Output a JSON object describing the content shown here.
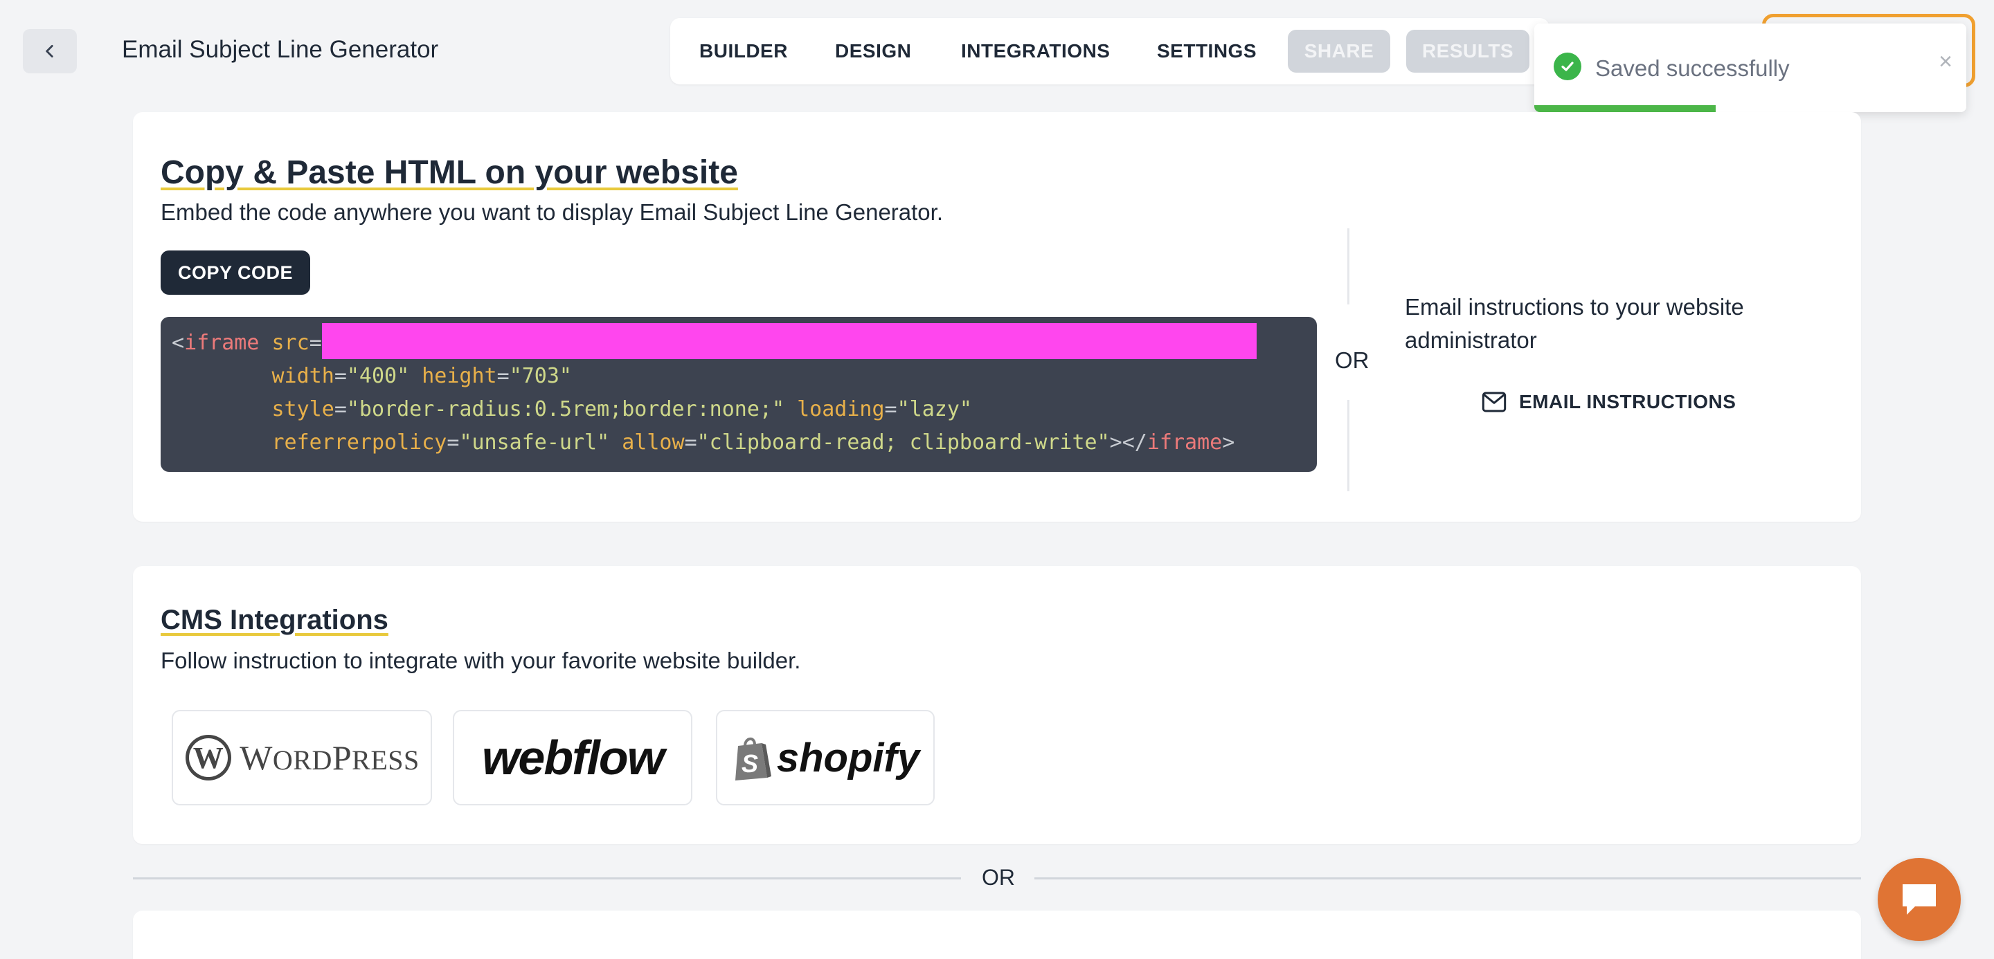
{
  "header": {
    "back_label": "back",
    "title": "Email Subject Line Generator",
    "tabs": [
      {
        "label": "BUILDER",
        "state": "normal"
      },
      {
        "label": "DESIGN",
        "state": "normal"
      },
      {
        "label": "INTEGRATIONS",
        "state": "normal"
      },
      {
        "label": "SETTINGS",
        "state": "normal"
      },
      {
        "label": "SHARE",
        "state": "disabled"
      },
      {
        "label": "RESULTS",
        "state": "disabled"
      }
    ]
  },
  "toast": {
    "message": "Saved successfully",
    "close_glyph": "×",
    "progress": 0.42,
    "accent": "#4cb648"
  },
  "embed": {
    "title": "Copy & Paste HTML on your website",
    "subtitle": "Embed the code anywhere you want to display Email Subject Line Generator.",
    "copy_button": "COPY CODE",
    "code": {
      "tag_open": "iframe",
      "src_attr": "src",
      "width_attr": "width",
      "width_val": "\"400\"",
      "height_attr": "height",
      "height_val": "\"703\"",
      "style_attr": "style",
      "style_val": "\"border-radius:0.5rem;border:none;\"",
      "loading_attr": "loading",
      "loading_val": "\"lazy\"",
      "referrer_attr": "referrerpolicy",
      "referrer_val": "\"unsafe-url\"",
      "allow_attr": "allow",
      "allow_val": "\"clipboard-read; clipboard-write\"",
      "tag_close": "iframe"
    },
    "or_label": "OR",
    "email_text": "Email instructions to your website administrator",
    "email_button": "EMAIL INSTRUCTIONS"
  },
  "cms": {
    "title": "CMS Integrations",
    "subtitle": "Follow instruction to integrate with your favorite website builder.",
    "logos": [
      {
        "name": "wordpress",
        "text_big_w": "W",
        "text_rest1": "ORD",
        "text_big_p": "P",
        "text_rest2": "RESS"
      },
      {
        "name": "webflow",
        "text": "webflow"
      },
      {
        "name": "shopify",
        "text": "shopify"
      }
    ]
  },
  "separator": {
    "label": "OR"
  },
  "colors": {
    "background": "#f3f4f6",
    "primary_dark": "#1f2937",
    "accent_orange": "#e07434",
    "title_underline": "#e8c93c",
    "redaction": "#ff46ee"
  }
}
